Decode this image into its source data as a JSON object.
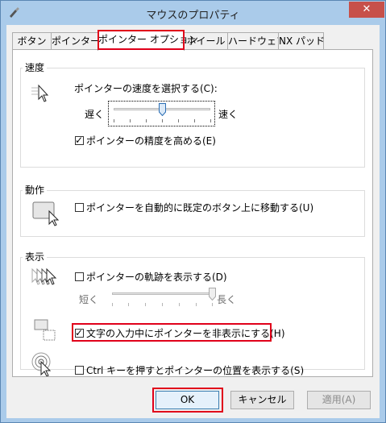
{
  "window": {
    "title": "マウスのプロパティ",
    "close_glyph": "✕"
  },
  "tabs": [
    {
      "label": "ボタン"
    },
    {
      "label": "ポインター"
    },
    {
      "label": "ポインター オプション"
    },
    {
      "label": "ホイール"
    },
    {
      "label": "ハードウェア"
    },
    {
      "label": "NX パッド"
    }
  ],
  "speed": {
    "group_label": "速度",
    "select_label": "ポインターの速度を選択する(C):",
    "slow_label": "遅く",
    "fast_label": "速く",
    "speed_level": 0.5,
    "precision_checkbox": {
      "label": "ポインターの精度を高める(E)",
      "checked": true,
      "tick": "✓"
    }
  },
  "motion": {
    "group_label": "動作",
    "snap_checkbox": {
      "label": "ポインターを自動的に既定のボタン上に移動する(U)",
      "checked": false
    }
  },
  "visibility": {
    "group_label": "表示",
    "trails_checkbox": {
      "label": "ポインターの軌跡を表示する(D)",
      "checked": false
    },
    "short_label": "短く",
    "long_label": "長く",
    "trail_level": 1.0,
    "hide_checkbox": {
      "label": "文字の入力中にポインターを非表示にする(H)",
      "checked": true,
      "tick": "✓"
    },
    "ctrl_checkbox": {
      "label": "Ctrl キーを押すとポインターの位置を表示する(S)",
      "checked": false
    }
  },
  "buttons": {
    "ok": "OK",
    "cancel": "キャンセル",
    "apply": "適用(A)"
  },
  "colors": {
    "highlight": "#e0001a",
    "frame": "#aacbea"
  }
}
